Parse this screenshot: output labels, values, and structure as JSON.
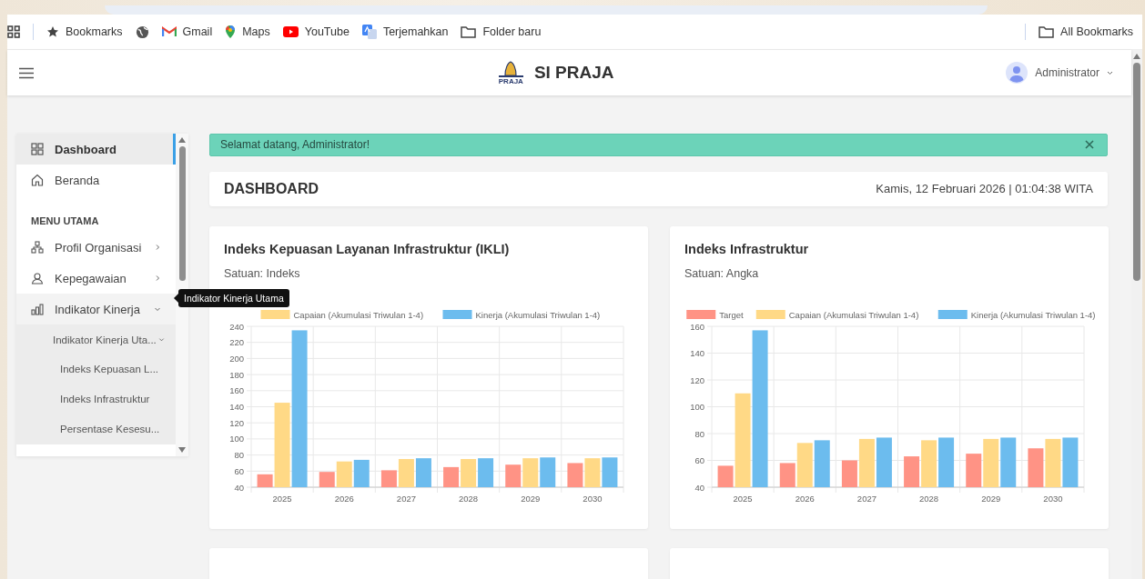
{
  "bookmarks_bar": {
    "items": [
      "Bookmarks",
      "Gmail",
      "Maps",
      "YouTube",
      "Terjemahkan",
      "Folder baru"
    ],
    "all_bookmarks": "All Bookmarks"
  },
  "header": {
    "brand": "SI PRAJA",
    "logo_text": "PRAJA",
    "user": "Administrator"
  },
  "sidebar": {
    "items": [
      {
        "label": "Dashboard",
        "selected": true
      },
      {
        "label": "Beranda",
        "selected": false
      }
    ],
    "section_heading": "MENU UTAMA",
    "menu": [
      {
        "label": "Profil Organisasi",
        "expanded": false,
        "selected": false
      },
      {
        "label": "Kepegawaian",
        "expanded": false,
        "selected": false
      },
      {
        "label": "Indikator Kinerja",
        "expanded": true,
        "selected": false,
        "children": [
          {
            "label": "Indikator Kinerja Uta...",
            "expanded": true,
            "selected": false,
            "children": [
              {
                "label": "Indeks Kepuasan L...",
                "selected": false
              },
              {
                "label": "Indeks Infrastruktur",
                "selected": false
              },
              {
                "label": "Persentase Kesesu...",
                "selected": false
              }
            ]
          }
        ]
      }
    ],
    "tooltip": "Indikator Kinerja Utama"
  },
  "alert": {
    "message": "Selamat datang, Administrator!"
  },
  "page_header": {
    "title": "DASHBOARD",
    "datetime": "Kamis, 12 Februari 2026 | 01:04:38 WITA"
  },
  "cards": [
    {
      "title": "Indeks Kepuasan Layanan Infrastruktur (IKLI)",
      "unit": "Satuan: Indeks",
      "chart_data": {
        "type": "bar",
        "grid": true,
        "legend": true,
        "categories": [
          "2025",
          "2026",
          "2027",
          "2028",
          "2029",
          "2030"
        ],
        "ylim": [
          40,
          240
        ],
        "yticks": [
          40,
          60,
          80,
          100,
          120,
          140,
          160,
          180,
          200,
          220,
          240
        ],
        "series": [
          {
            "color": "#ff9385",
            "values": [
              56,
              59,
              61,
              65,
              68,
              70
            ]
          },
          {
            "name": "Capaian (Akumulasi Triwulan 1-4)",
            "color": "#ffd986",
            "values": [
              145,
              72,
              75,
              75,
              76,
              76
            ]
          },
          {
            "name": "Kinerja (Akumulasi Triwulan 1-4)",
            "color": "#6cbcee",
            "values": [
              235,
              74,
              76,
              76,
              77,
              77
            ]
          }
        ]
      }
    },
    {
      "title": "Indeks Infrastruktur",
      "unit": "Satuan: Angka",
      "chart_data": {
        "type": "bar",
        "grid": true,
        "legend": true,
        "categories": [
          "2025",
          "2026",
          "2027",
          "2028",
          "2029",
          "2030"
        ],
        "ylim": [
          40,
          160
        ],
        "yticks": [
          40,
          60,
          80,
          100,
          120,
          140,
          160
        ],
        "series": [
          {
            "name": "Target",
            "color": "#ff9385",
            "values": [
              56,
              58,
              60,
              63,
              65,
              69
            ]
          },
          {
            "name": "Capaian (Akumulasi Triwulan 1-4)",
            "color": "#ffd986",
            "values": [
              110,
              73,
              76,
              75,
              76,
              76
            ]
          },
          {
            "name": "Kinerja (Akumulasi Triwulan 1-4)",
            "color": "#6cbcee",
            "values": [
              157,
              75,
              77,
              77,
              77,
              77
            ]
          }
        ]
      }
    }
  ]
}
